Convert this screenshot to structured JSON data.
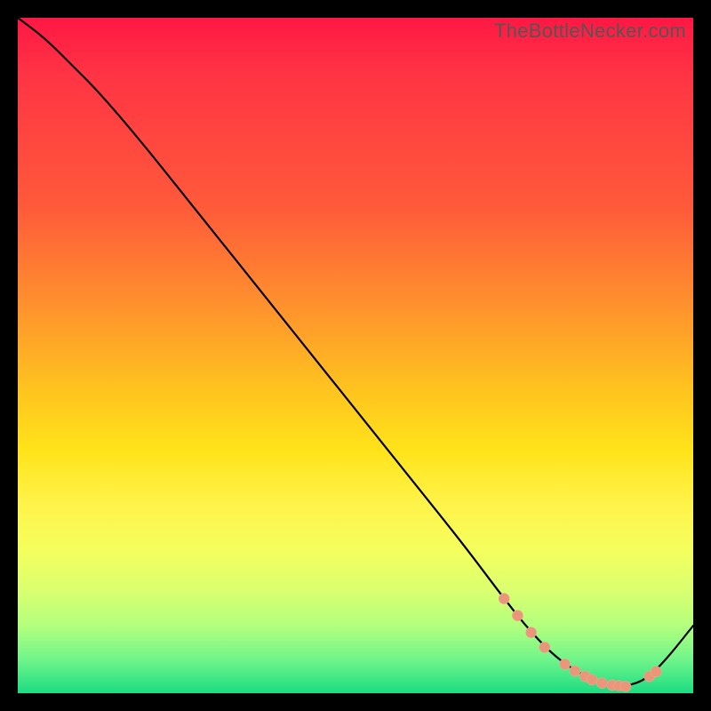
{
  "watermark": "TheBottleNecker.com",
  "colors": {
    "background": "#000000",
    "curve": "#000000",
    "marker": "#e9967a"
  },
  "chart_data": {
    "type": "line",
    "title": "",
    "xlabel": "",
    "ylabel": "",
    "xlim": [
      0,
      100
    ],
    "ylim": [
      0,
      100
    ],
    "series": [
      {
        "name": "bottleneck-curve",
        "x": [
          0,
          4,
          8,
          12,
          18,
          26,
          34,
          42,
          50,
          58,
          66,
          72,
          76,
          80,
          84,
          86,
          88,
          90,
          93,
          96,
          100
        ],
        "y": [
          100,
          97,
          93,
          89,
          82,
          72,
          62,
          52,
          42,
          32,
          22,
          14,
          9,
          5,
          2.5,
          1.5,
          1,
          1,
          2,
          5,
          10
        ]
      }
    ],
    "markers": {
      "name": "highlight-points",
      "x": [
        72,
        74,
        76,
        78,
        81,
        82.5,
        84,
        85,
        86.5,
        88,
        89,
        90,
        93.5,
        94.5
      ],
      "y": [
        14,
        11.5,
        9,
        6.8,
        4.3,
        3.3,
        2.5,
        2.0,
        1.5,
        1.2,
        1.1,
        1.0,
        2.5,
        3.2
      ]
    }
  }
}
